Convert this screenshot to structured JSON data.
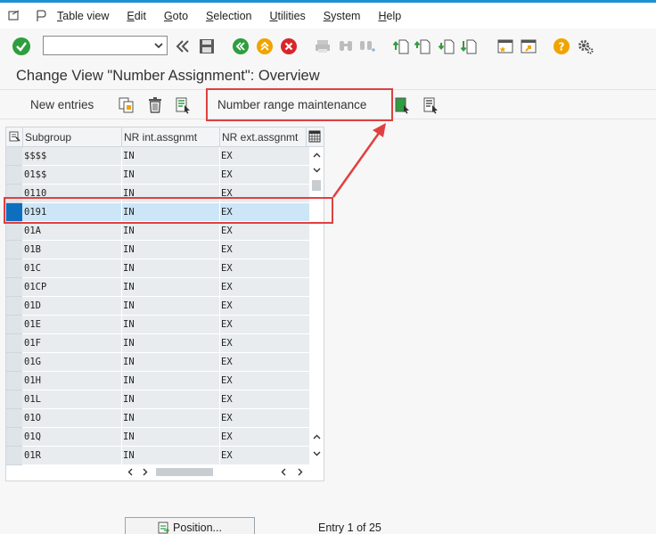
{
  "menubar": {
    "items": [
      {
        "label": "Table view",
        "mnemonic": "T",
        "rest": "able view"
      },
      {
        "label": "Edit",
        "mnemonic": "E",
        "rest": "dit"
      },
      {
        "label": "Goto",
        "mnemonic": "G",
        "rest": "oto"
      },
      {
        "label": "Selection",
        "mnemonic": "S",
        "rest": "election"
      },
      {
        "label": "Utilities",
        "mnemonic": "U",
        "rest": "tilities"
      },
      {
        "label": "System",
        "mnemonic": "S",
        "rest": "ystem"
      },
      {
        "label": "Help",
        "mnemonic": "H",
        "rest": "elp"
      }
    ]
  },
  "toolbar": {
    "command_value": "",
    "icons": [
      "enter-check-icon",
      "back-icon",
      "save-icon",
      "back-green-icon",
      "exit-yellow-icon",
      "cancel-red-icon",
      "print-icon",
      "find-icon",
      "find-next-icon",
      "first-page-icon",
      "previous-page-icon",
      "next-page-icon",
      "last-page-icon",
      "create-session-icon",
      "shortcut-icon",
      "help-icon",
      "settings-gear-icon"
    ]
  },
  "title": "Change View \"Number Assignment\": Overview",
  "apptoolbar": {
    "new_entries": "New entries",
    "number_range_maintenance": "Number range maintenance"
  },
  "table": {
    "columns": [
      "Subgroup",
      "NR int.assgnmt",
      "NR ext.assgnmt"
    ],
    "rows": [
      [
        "$$$$",
        "IN",
        "EX"
      ],
      [
        "01$$",
        "IN",
        "EX"
      ],
      [
        "0110",
        "IN",
        "EX"
      ],
      [
        "0191",
        "IN",
        "EX"
      ],
      [
        "01A",
        "IN",
        "EX"
      ],
      [
        "01B",
        "IN",
        "EX"
      ],
      [
        "01C",
        "IN",
        "EX"
      ],
      [
        "01CP",
        "IN",
        "EX"
      ],
      [
        "01D",
        "IN",
        "EX"
      ],
      [
        "01E",
        "IN",
        "EX"
      ],
      [
        "01F",
        "IN",
        "EX"
      ],
      [
        "01G",
        "IN",
        "EX"
      ],
      [
        "01H",
        "IN",
        "EX"
      ],
      [
        "01L",
        "IN",
        "EX"
      ],
      [
        "01O",
        "IN",
        "EX"
      ],
      [
        "01Q",
        "IN",
        "EX"
      ],
      [
        "01R",
        "IN",
        "EX"
      ]
    ],
    "highlighted_row": 3
  },
  "footer": {
    "position_button": "Position...",
    "entry_info": "Entry 1 of 25"
  },
  "colors": {
    "accent_blue": "#1f8fd6",
    "annotation_red": "#e04040",
    "selected_row": "#cde6f7"
  }
}
